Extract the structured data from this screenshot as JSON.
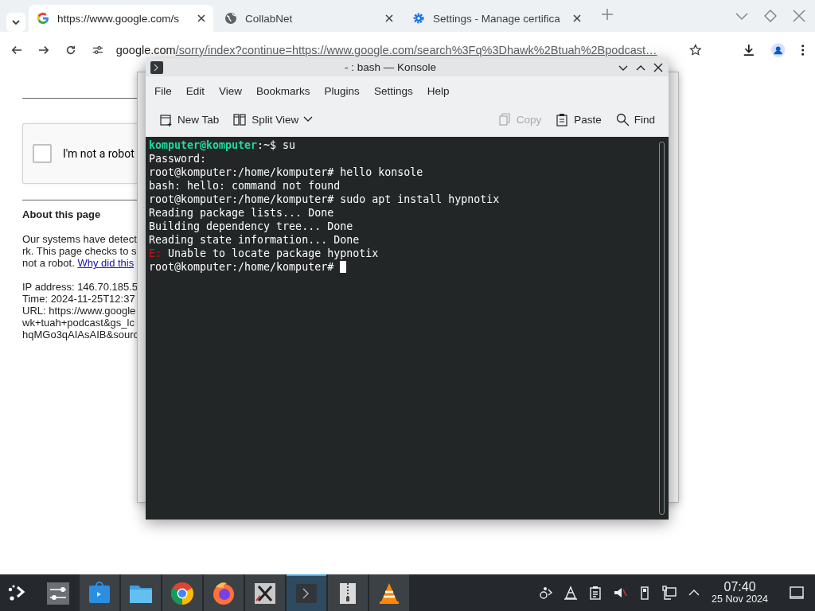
{
  "browser": {
    "tabs": [
      {
        "title": "https://www.google.com/s",
        "kind": "google",
        "selected": true
      },
      {
        "title": "CollabNet",
        "kind": "globe",
        "selected": false
      },
      {
        "title": "Settings - Manage certifica",
        "kind": "gear",
        "selected": false
      }
    ],
    "address": {
      "host": "google.com",
      "path": "/sorry/index?continue=https://www.google.com/search%3Fq%3Dhawk%2Btuah%2Bpodcast…"
    }
  },
  "page": {
    "checkbox": {
      "label": "I'm not a robot",
      "checked": false
    },
    "about_heading": "About this page",
    "paragraph_lines": [
      "Our systems have detect",
      "rk. This page checks to s",
      "not a robot."
    ],
    "link": "Why did this",
    "details": [
      "IP address: 146.70.185.5",
      "Time: 2024-11-25T12:37",
      "URL: https://www.google",
      "wk+tuah+podcast&gs_lc",
      "hqMGo3qAIAsAIB&sourc"
    ]
  },
  "konsole": {
    "title": "- : bash — Konsole",
    "menu": [
      "File",
      "Edit",
      "View",
      "Bookmarks",
      "Plugins",
      "Settings",
      "Help"
    ],
    "toolbar": [
      {
        "label": "New Tab",
        "kind": "new-tab",
        "disabled": false
      },
      {
        "label": "Split View",
        "kind": "split",
        "disabled": false
      },
      {
        "label": "Copy",
        "kind": "copy",
        "disabled": true
      },
      {
        "label": "Paste",
        "kind": "paste",
        "disabled": false
      },
      {
        "label": "Find",
        "kind": "find",
        "disabled": false
      }
    ],
    "lines": [
      {
        "kind": "user_prompt",
        "user": "komputer@komputer",
        "text": ":~$ su"
      },
      {
        "kind": "output",
        "text": "Password:"
      },
      {
        "kind": "output",
        "text": "root@komputer:/home/komputer# hello konsole"
      },
      {
        "kind": "output",
        "text": "bash: hello: command not found"
      },
      {
        "kind": "output",
        "text": "root@komputer:/home/komputer# sudo apt install hypnotix"
      },
      {
        "kind": "output",
        "text": "Reading package lists... Done"
      },
      {
        "kind": "output",
        "text": "Building dependency tree... Done"
      },
      {
        "kind": "output",
        "text": "Reading state information... Done"
      },
      {
        "kind": "error",
        "tag": "E:",
        "text": "Unable to locate package hypnotix"
      },
      {
        "kind": "cursor",
        "text": "root@komputer:/home/komputer#"
      }
    ]
  },
  "taskbar": {
    "tasks": [
      {
        "kind": "mixer",
        "running": false,
        "selected": false
      },
      {
        "kind": "store",
        "running": true,
        "selected": false
      },
      {
        "kind": "folder",
        "running": true,
        "selected": false
      },
      {
        "kind": "chrome",
        "running": true,
        "selected": false
      },
      {
        "kind": "firefox",
        "running": true,
        "selected": false
      },
      {
        "kind": "x",
        "running": true,
        "selected": false
      },
      {
        "kind": "terminal",
        "running": true,
        "selected": true
      },
      {
        "kind": "archive",
        "running": true,
        "selected": false
      },
      {
        "kind": "cone",
        "running": true,
        "selected": false
      }
    ],
    "time": "07:40",
    "date": "25 Nov 2024"
  }
}
